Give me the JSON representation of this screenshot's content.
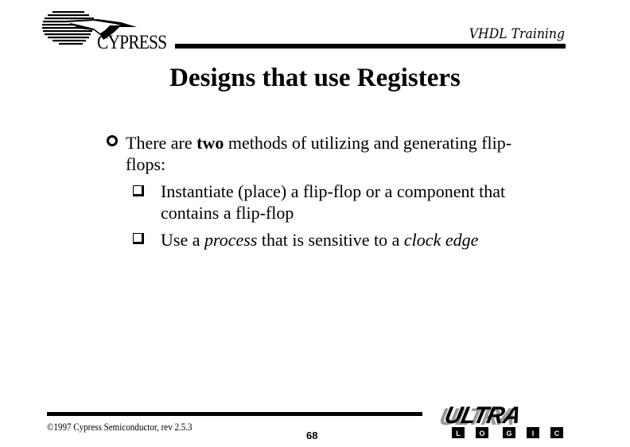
{
  "header": {
    "logo_name": "CYPRESS",
    "course_label": "VHDL Training"
  },
  "slide": {
    "title": "Designs that use Registers",
    "bullets": [
      {
        "level": 1,
        "icon": "circle-bullet-icon",
        "parts": [
          "There are ",
          "two",
          " methods of utilizing and generating flip-flops:"
        ]
      },
      {
        "level": 2,
        "icon": "square-bullet-icon",
        "text": "Instantiate (place) a flip-flop or a component that contains a flip-flop"
      },
      {
        "level": 2,
        "icon": "square-bullet-icon",
        "parts": [
          "Use a ",
          "process",
          " that is sensitive to a ",
          "clock edge"
        ]
      }
    ]
  },
  "footer": {
    "copyright": "©1997 Cypress Semiconductor, rev 2.5.3",
    "page_number": "68",
    "brand_top": "ULTRA",
    "brand_letters": [
      "L",
      "O",
      "G",
      "I",
      "C"
    ]
  }
}
